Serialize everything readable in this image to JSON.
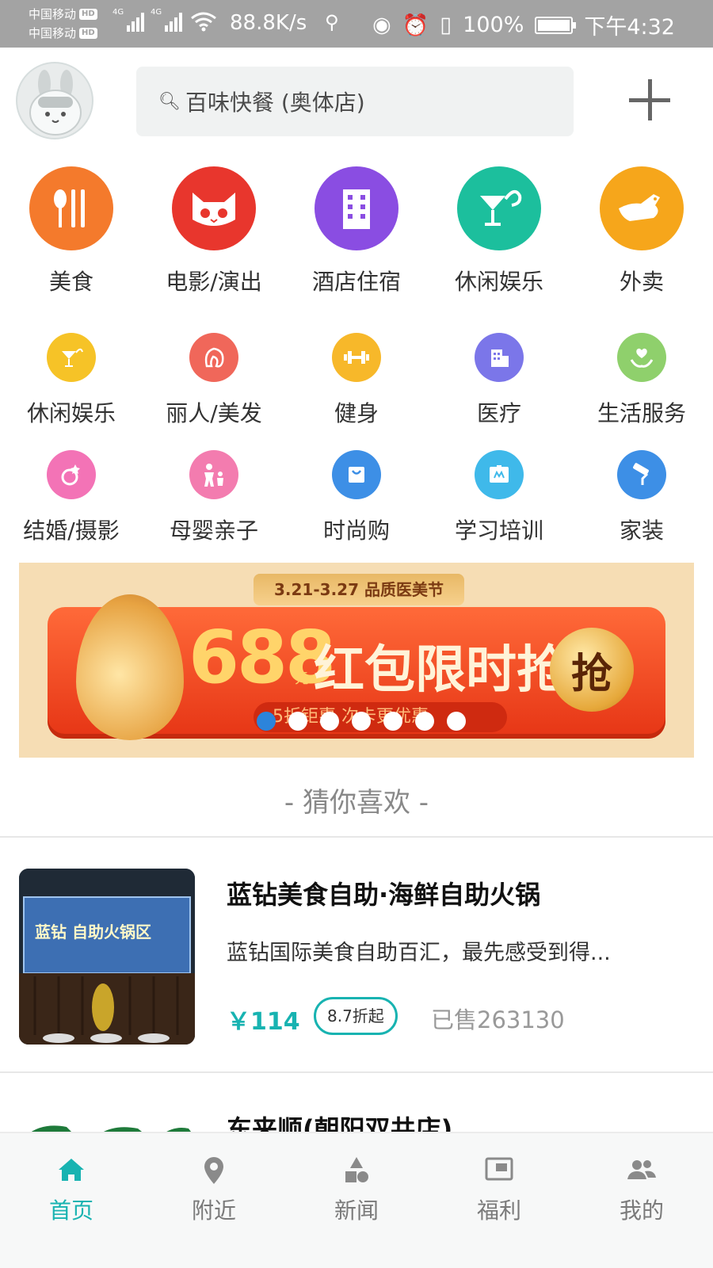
{
  "status_bar": {
    "carrier1": "中国移动",
    "carrier2": "中国移动",
    "hd": "HD",
    "net1": "4G",
    "net2": "4G",
    "speed": "88.8K/s",
    "battery": "100%",
    "time": "下午4:32"
  },
  "header": {
    "search_placeholder": "百味快餐 (奥体店)"
  },
  "big_categories": [
    {
      "label": "美食",
      "color": "#f47a2c",
      "icon": "fork-knife-icon"
    },
    {
      "label": "电影/演出",
      "color": "#e8362d",
      "icon": "cat-icon"
    },
    {
      "label": "酒店住宿",
      "color": "#8a4de2",
      "icon": "building-icon"
    },
    {
      "label": "休闲娱乐",
      "color": "#1cbf9d",
      "icon": "cocktail-icon"
    },
    {
      "label": "外卖",
      "color": "#f6a61b",
      "icon": "kangaroo-icon"
    }
  ],
  "small_categories_row1": [
    {
      "label": "休闲娱乐",
      "color": "#f6c327",
      "icon": "cocktail-icon"
    },
    {
      "label": "丽人/美发",
      "color": "#f0675a",
      "icon": "hair-icon"
    },
    {
      "label": "健身",
      "color": "#f7b82a",
      "icon": "dumbbell-icon"
    },
    {
      "label": "医疗",
      "color": "#7b76e9",
      "icon": "hospital-icon"
    },
    {
      "label": "生活服务",
      "color": "#8fd06c",
      "icon": "heart-hand-icon"
    }
  ],
  "small_categories_row2": [
    {
      "label": "结婚/摄影",
      "color": "#f373b6",
      "icon": "ring-icon"
    },
    {
      "label": "母婴亲子",
      "color": "#f37caf",
      "icon": "family-icon"
    },
    {
      "label": "时尚购",
      "color": "#3d8fe6",
      "icon": "shopping-bag-icon"
    },
    {
      "label": "学习培训",
      "color": "#3fb9ea",
      "icon": "book-icon"
    },
    {
      "label": "家装",
      "color": "#3d8fe6",
      "icon": "paint-roller-icon"
    }
  ],
  "banner": {
    "tag": "3.21-3.27 品质医美节",
    "amount": "688",
    "unit": "元",
    "headline": "红包限时抢",
    "sub": "5折钜惠  次卡更优惠",
    "button": "抢",
    "dots": 7,
    "active_dot": 0
  },
  "guess": {
    "title": "- 猜你喜欢 -"
  },
  "deals": [
    {
      "title": "蓝钻美食自助·海鲜自助火锅",
      "desc": "蓝钻国际美食自助百汇，最先感受到得...",
      "price": "￥114",
      "discount": "8.7折起",
      "sold": "已售263130",
      "thumb_text": "蓝钻  自助火锅区"
    },
    {
      "title": "东来顺(朝阳双井店)"
    }
  ],
  "bottom_nav": [
    {
      "label": "首页",
      "icon": "home-icon",
      "active": true
    },
    {
      "label": "附近",
      "icon": "location-pin-icon",
      "active": false
    },
    {
      "label": "新闻",
      "icon": "shapes-icon",
      "active": false
    },
    {
      "label": "福利",
      "icon": "tv-icon",
      "active": false
    },
    {
      "label": "我的",
      "icon": "people-icon",
      "active": false
    }
  ],
  "colors": {
    "accent": "#18b3b1",
    "status_bar": "#a3a3a3"
  }
}
